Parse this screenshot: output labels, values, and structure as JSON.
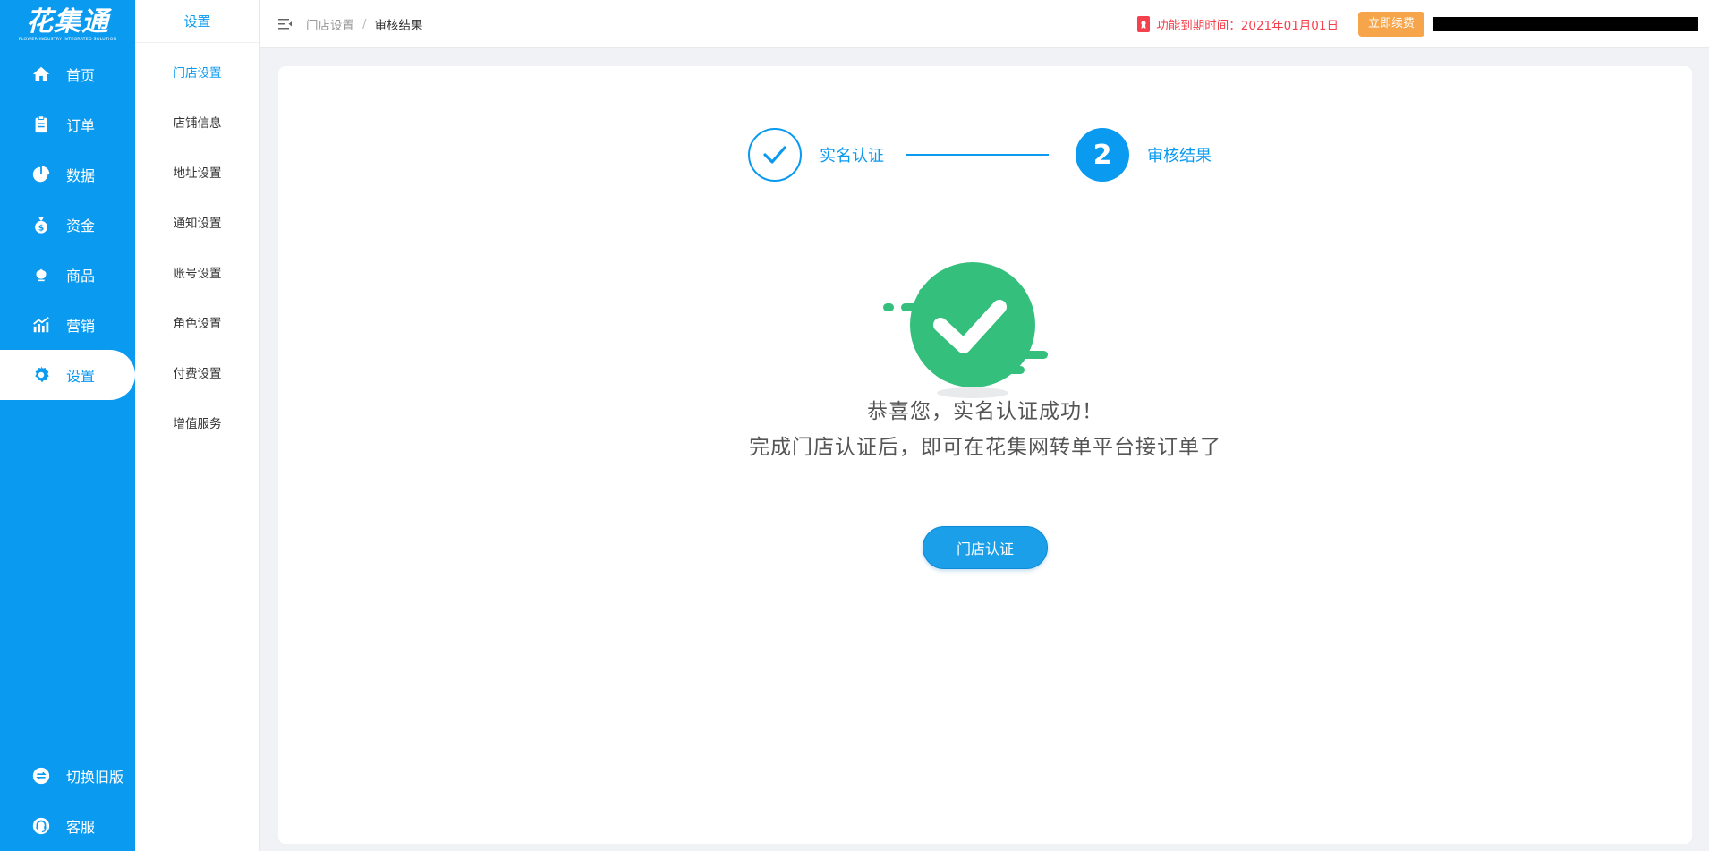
{
  "brand": {
    "logo_text": "花集通",
    "logo_sub": "FLOWER-INDUSTRY INTEGRATED SOLUTION"
  },
  "primary_nav": [
    {
      "label": "首页",
      "icon": "home-icon"
    },
    {
      "label": "订单",
      "icon": "clipboard-icon"
    },
    {
      "label": "数据",
      "icon": "pie-chart-icon"
    },
    {
      "label": "资金",
      "icon": "money-bag-icon"
    },
    {
      "label": "商品",
      "icon": "flower-icon"
    },
    {
      "label": "营销",
      "icon": "trend-chart-icon"
    },
    {
      "label": "设置",
      "icon": "gear-icon",
      "active": true
    }
  ],
  "bottom_nav": [
    {
      "label": "切换旧版",
      "icon": "switch-icon"
    },
    {
      "label": "客服",
      "icon": "headset-icon"
    }
  ],
  "secondary_nav": {
    "title": "设置",
    "items": [
      {
        "label": "门店设置",
        "active": true
      },
      {
        "label": "店铺信息"
      },
      {
        "label": "地址设置"
      },
      {
        "label": "通知设置"
      },
      {
        "label": "账号设置"
      },
      {
        "label": "角色设置"
      },
      {
        "label": "付费设置"
      },
      {
        "label": "增值服务"
      }
    ]
  },
  "topbar": {
    "breadcrumb": [
      "门店设置",
      "审核结果"
    ],
    "expire_text": "功能到期时间：2021年01月01日",
    "renew_label": "立即续费"
  },
  "steps": {
    "step1_label": "实名认证",
    "step2_number": "2",
    "step2_label": "审核结果"
  },
  "result": {
    "line1": "恭喜您，实名认证成功！",
    "line2": "完成门店认证后，即可在花集网转单平台接订单了",
    "button_label": "门店认证"
  },
  "colors": {
    "primary": "#0a9af0",
    "success": "#34c07c",
    "warning": "#f7a54a",
    "danger": "#f5414d"
  }
}
